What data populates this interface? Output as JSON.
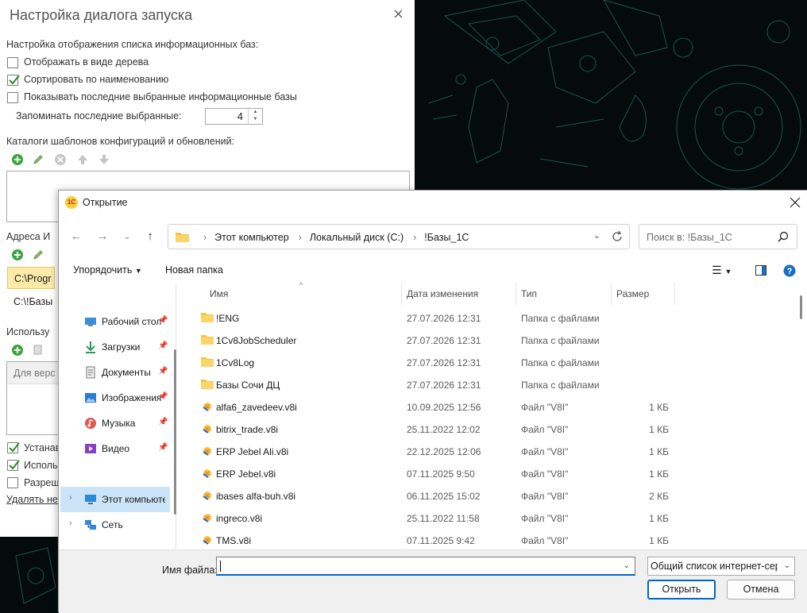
{
  "settings": {
    "title": "Настройка диалога запуска",
    "list_section": "Настройка отображения списка информационных баз:",
    "opt_tree": "Отображать в виде дерева",
    "opt_sort": "Сортировать по наименованию",
    "opt_recent": "Показывать последние выбранные информационные базы",
    "remember_label": "Запоминать последние выбранные:",
    "remember_value": "4",
    "templates_section": "Каталоги шаблонов конфигураций и обновлений:",
    "addresses_section": "Адреса И",
    "addresses": [
      "C:\\Progr",
      "C:\\!Базы"
    ],
    "use_section": "Использу",
    "versions_header": "Для верс",
    "opt_install": "Устанав",
    "opt_use": "Исполь",
    "opt_allow": "Разреш",
    "delete_link": "Удалять не"
  },
  "open": {
    "title": "Открытие",
    "breadcrumbs": [
      "Этот компьютер",
      "Локальный диск (C:)",
      "!Базы_1С"
    ],
    "search_placeholder": "Поиск в: !Базы_1С",
    "organize": "Упорядочить",
    "new_folder": "Новая папка",
    "nav": [
      {
        "label": "Рабочий стол",
        "icon": "desktop-icon"
      },
      {
        "label": "Загрузки",
        "icon": "downloads-icon"
      },
      {
        "label": "Документы",
        "icon": "documents-icon"
      },
      {
        "label": "Изображения",
        "icon": "pictures-icon"
      },
      {
        "label": "Музыка",
        "icon": "music-icon"
      },
      {
        "label": "Видео",
        "icon": "video-icon"
      },
      {
        "label": "Этот компьютер",
        "icon": "computer-icon"
      },
      {
        "label": "Сеть",
        "icon": "network-icon"
      }
    ],
    "columns": {
      "name": "Имя",
      "date": "Дата изменения",
      "type": "Тип",
      "size": "Размер"
    },
    "files": [
      {
        "name": "!ENG",
        "date": "27.07.2026 12:31",
        "type": "Папка с файлами",
        "size": "",
        "kind": "folder"
      },
      {
        "name": "1Cv8JobScheduler",
        "date": "27.07.2026 12:31",
        "type": "Папка с файлами",
        "size": "",
        "kind": "folder"
      },
      {
        "name": "1Cv8Log",
        "date": "27.07.2026 12:31",
        "type": "Папка с файлами",
        "size": "",
        "kind": "folder"
      },
      {
        "name": "Базы Сочи ДЦ",
        "date": "27.07.2026 12:31",
        "type": "Папка с файлами",
        "size": "",
        "kind": "folder"
      },
      {
        "name": "alfa6_zavedeev.v8i",
        "date": "10.09.2025 12:56",
        "type": "Файл \"V8I\"",
        "size": "1 КБ",
        "kind": "v8i"
      },
      {
        "name": "bitrix_trade.v8i",
        "date": "25.11.2022 12:02",
        "type": "Файл \"V8I\"",
        "size": "1 КБ",
        "kind": "v8i"
      },
      {
        "name": "ERP Jebel Ali.v8i",
        "date": "22.12.2025 12:06",
        "type": "Файл \"V8I\"",
        "size": "1 КБ",
        "kind": "v8i"
      },
      {
        "name": "ERP Jebel.v8i",
        "date": "07.11.2025 9:50",
        "type": "Файл \"V8I\"",
        "size": "1 КБ",
        "kind": "v8i"
      },
      {
        "name": "ibases alfa-buh.v8i",
        "date": "06.11.2025 15:02",
        "type": "Файл \"V8I\"",
        "size": "2 КБ",
        "kind": "v8i"
      },
      {
        "name": "ingreco.v8i",
        "date": "25.11.2022 11:58",
        "type": "Файл \"V8I\"",
        "size": "1 КБ",
        "kind": "v8i"
      },
      {
        "name": "TMS.v8i",
        "date": "07.11.2025 9:42",
        "type": "Файл \"V8I\"",
        "size": "1 КБ",
        "kind": "v8i"
      }
    ],
    "filename_label": "Имя файла:",
    "filename_value": "",
    "filetype_value": "Общий список интернет-серверов",
    "open_button": "Открыть",
    "cancel_button": "Отмена"
  }
}
